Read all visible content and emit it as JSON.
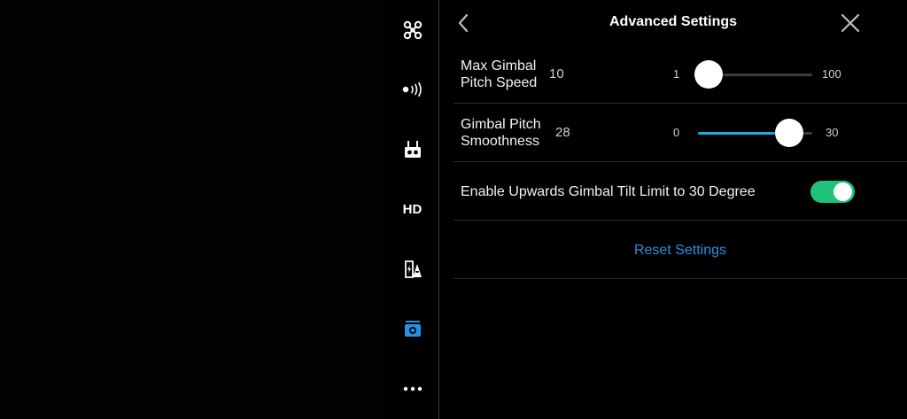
{
  "header": {
    "title": "Advanced Settings",
    "back_icon": "chevron-left-icon",
    "close_icon": "close-icon"
  },
  "sidebar": {
    "items": [
      {
        "name": "aircraft",
        "icon": "drone-icon"
      },
      {
        "name": "signal",
        "icon": "signal-icon"
      },
      {
        "name": "remote-controller",
        "icon": "remote-controller-icon"
      },
      {
        "name": "hd",
        "icon": "hd-icon",
        "label": "HD"
      },
      {
        "name": "battery",
        "icon": "battery-icon"
      },
      {
        "name": "gimbal",
        "icon": "gimbal-camera-icon",
        "active": true
      },
      {
        "name": "more",
        "icon": "more-icon"
      }
    ],
    "active_color": "#2b8fe0"
  },
  "settings": {
    "max_pitch_speed": {
      "label_line1": "Max Gimbal",
      "label_line2": "Pitch Speed",
      "value": "10",
      "min": "1",
      "max": "100",
      "level": 0.09
    },
    "pitch_smoothness": {
      "label_line1": "Gimbal Pitch",
      "label_line2": "Smoothness",
      "value": "28",
      "min": "0",
      "max": "30",
      "level": 0.8
    },
    "tilt_limit": {
      "label": "Enable Upwards Gimbal Tilt Limit to 30 Degree",
      "enabled": true
    },
    "reset_label": "Reset Settings"
  },
  "colors": {
    "slider_fill": "#1fa9e1",
    "toggle_on": "#20c27a",
    "link": "#2b8fe0"
  }
}
